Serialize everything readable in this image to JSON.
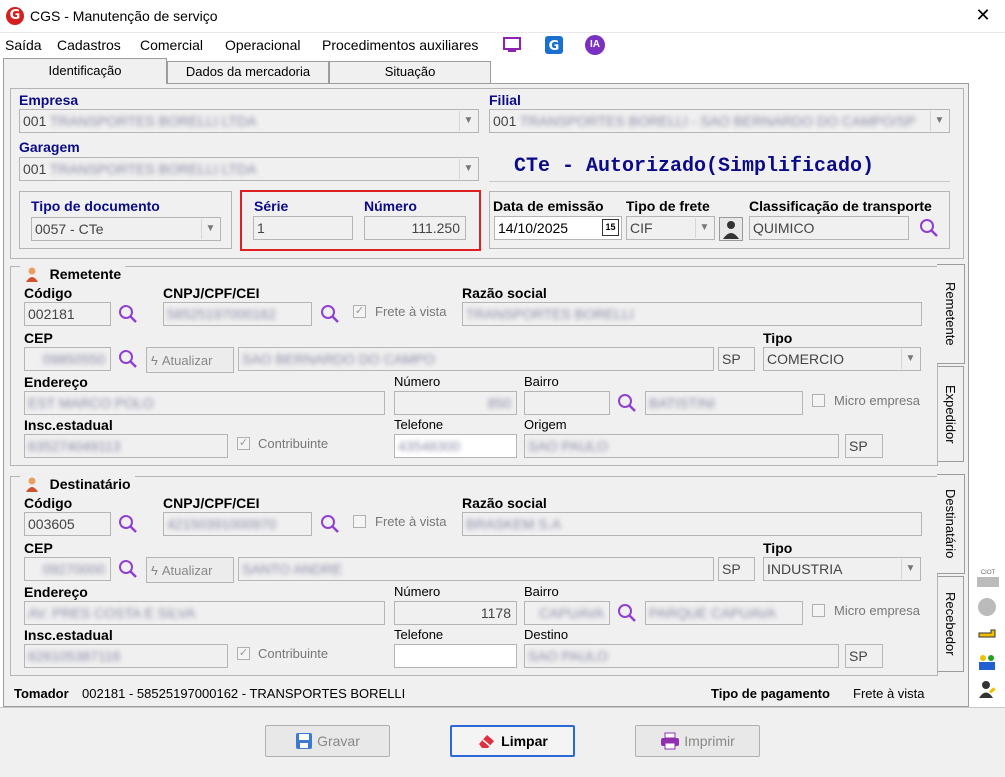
{
  "window": {
    "title": "CGS - Manutenção de serviço",
    "close": "✕"
  },
  "menu": {
    "items": [
      "Saída",
      "Cadastros",
      "Comercial",
      "Operacional",
      "Procedimentos auxiliares"
    ],
    "icons": [
      "monitor-icon",
      "g-logo-icon",
      "ia-icon"
    ],
    "ia_label": "IA"
  },
  "tabs": [
    "Identificação",
    "Dados da mercadoria",
    "Situação"
  ],
  "empresa": {
    "label": "Empresa",
    "value": "001",
    "blurred": "TRANSPORTES BORELLI LTDA"
  },
  "filial": {
    "label": "Filial",
    "value": "001",
    "blurred": "TRANSPORTES BORELLI - SAO BERNARDO DO CAMPO/SP"
  },
  "garagem": {
    "label": "Garagem",
    "value": "001",
    "blurred": "TRANSPORTES BORELLI LTDA"
  },
  "status": "CTe - Autorizado(Simplificado)",
  "tipo_documento": {
    "label": "Tipo de documento",
    "value": "0057 - CTe"
  },
  "serie": {
    "label": "Série",
    "value": "1"
  },
  "numero": {
    "label": "Número",
    "value": "111.250"
  },
  "data_emissao": {
    "label": "Data de emissão",
    "value": "14/10/2025",
    "cal": "15"
  },
  "tipo_frete": {
    "label": "Tipo de frete",
    "value": "CIF"
  },
  "classificacao": {
    "label": "Classificação de transporte",
    "value": "QUIMICO"
  },
  "remetente": {
    "title": "Remetente",
    "codigo_label": "Código",
    "codigo": "002181",
    "cnpj_label": "CNPJ/CPF/CEI",
    "cnpj": "58525197000162",
    "frete_vista": "Frete à vista",
    "razao_label": "Razão social",
    "razao": "TRANSPORTES BORELLI",
    "cep_label": "CEP",
    "cep": "09850550",
    "atualizar": "Atualizar",
    "cidade": "SAO BERNARDO DO CAMPO",
    "uf": "SP",
    "tipo_label": "Tipo",
    "tipo": "COMERCIO",
    "endereco_label": "Endereço",
    "endereco": "EST MARCO POLO",
    "numero_label": "Número",
    "numero": "850",
    "bairro_label": "Bairro",
    "bairro": "BATISTINI",
    "micro": "Micro empresa",
    "ie_label": "Insc.estadual",
    "ie": "635274049113",
    "contribuinte": "Contribuinte",
    "tel_label": "Telefone",
    "tel": "43548300",
    "origem_label": "Origem",
    "origem": "SAO PAULO",
    "origem_uf": "SP"
  },
  "destinatario": {
    "title": "Destinatário",
    "codigo_label": "Código",
    "codigo": "003605",
    "cnpj_label": "CNPJ/CPF/CEI",
    "cnpj": "42150391000970",
    "frete_vista": "Frete à vista",
    "razao_label": "Razão social",
    "razao": "BRASKEM S.A",
    "cep_label": "CEP",
    "cep": "09270000",
    "atualizar": "Atualizar",
    "cidade": "SANTO ANDRE",
    "uf": "SP",
    "tipo_label": "Tipo",
    "tipo": "INDUSTRIA",
    "endereco_label": "Endereço",
    "endereco": "AV. PRES COSTA E SILVA",
    "numero_label": "Número",
    "numero": "1178",
    "bairro_label": "Bairro",
    "bairro": "CAPUAVA",
    "bairro2": "PARQUE CAPUAVA",
    "micro": "Micro empresa",
    "ie_label": "Insc.estadual",
    "ie": "626105387116",
    "contribuinte": "Contribuinte",
    "tel_label": "Telefone",
    "tel": "",
    "destino_label": "Destino",
    "destino": "SAO PAULO",
    "destino_uf": "SP"
  },
  "sidetabs": [
    "Remetente",
    "Expedidor",
    "Destinatário",
    "Recebedor"
  ],
  "tomador": {
    "label": "Tomador",
    "value": "002181 - 58525197000162 - TRANSPORTES BORELLI"
  },
  "pagamento": {
    "label": "Tipo de pagamento",
    "value": "Frete à vista"
  },
  "buttons": {
    "gravar": "Gravar",
    "limpar": "Limpar",
    "imprimir": "Imprimir"
  },
  "right_icons": {
    "ciot": "CIOT"
  }
}
